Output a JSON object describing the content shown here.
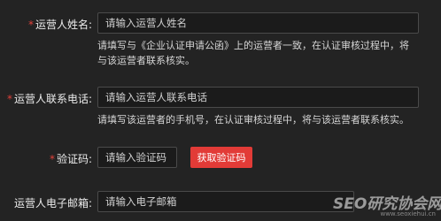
{
  "form": {
    "operator_name": {
      "required_mark": "*",
      "label": "运营人姓名:",
      "placeholder": "请输入运营人姓名",
      "hint": "请填写与《企业认证申请公函》上的运营者一致，在认证审核过程中，将与该运营者联系核实。"
    },
    "operator_phone": {
      "required_mark": "*",
      "label": "运营人联系电话:",
      "placeholder": "请输入运营人联系电话",
      "hint": "请填写该运营者的手机号，在认证审核过程中，将与该运营者联系核实。"
    },
    "verification_code": {
      "required_mark": "*",
      "label": "验证码:",
      "placeholder": "请输入验证码",
      "button_label": "获取验证码"
    },
    "operator_email": {
      "label": "运营人电子邮箱:",
      "placeholder": "请输入电子邮箱"
    }
  },
  "watermark": {
    "main": "SEO研究协会网",
    "sub": "www.seoxiehui.cn"
  },
  "colors": {
    "background": "#232323",
    "required_star": "#e0403a",
    "primary_button": "#e23b37"
  }
}
